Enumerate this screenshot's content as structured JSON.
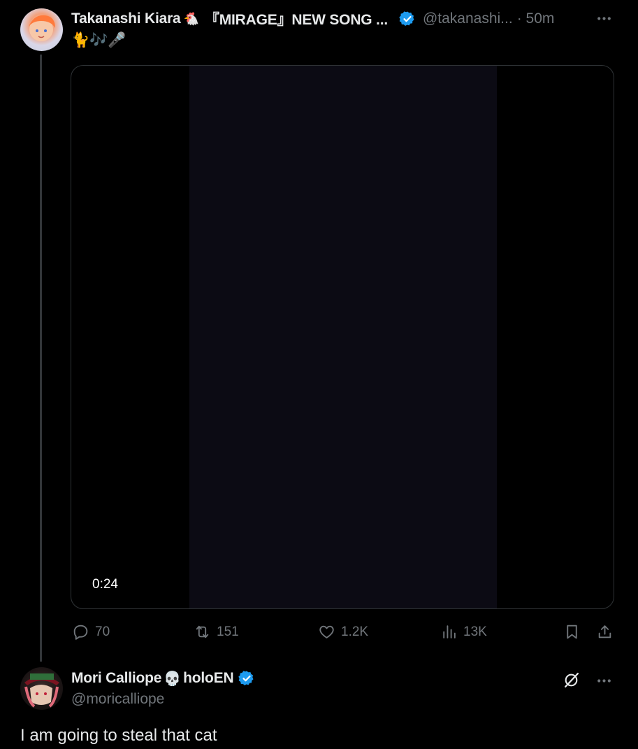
{
  "tweet1": {
    "display_name": "Takanashi Kiara",
    "name_emoji": "🐔",
    "name_suffix": "『MIRAGE』NEW SONG ...",
    "handle": "@takanashi...",
    "time": "· 50m",
    "text": "🐈🎶🎤",
    "video": {
      "duration": "0:24"
    },
    "actions": {
      "replies": "70",
      "reposts": "151",
      "likes": "1.2K",
      "views": "13K"
    }
  },
  "tweet2": {
    "display_name": "Mori Calliope",
    "name_emoji": "💀",
    "name_suffix": "holoEN",
    "handle": "@moricalliope",
    "text": "I am going to steal that cat"
  },
  "icons": {
    "verified": "verified-badge-icon",
    "more": "more-icon",
    "reply": "reply-icon",
    "repost": "repost-icon",
    "like": "heart-icon",
    "views": "views-icon",
    "bookmark": "bookmark-icon",
    "share": "share-icon",
    "grok": "grok-icon"
  },
  "colors": {
    "background": "#000000",
    "text": "#e7e9ea",
    "muted": "#71767b",
    "verified": "#1d9bf0",
    "video_panel": "#0c0b14"
  }
}
